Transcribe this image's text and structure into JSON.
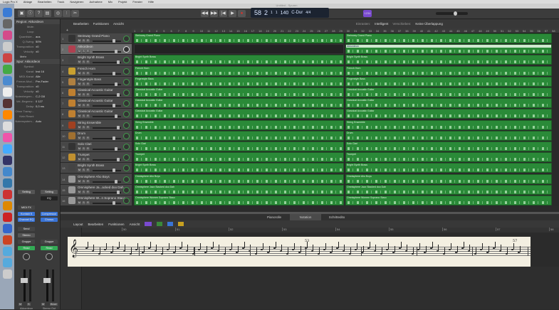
{
  "menubar": {
    "items": [
      "Logic Pro X",
      "Ablage",
      "Bearbeiten",
      "Track",
      "Navigieren",
      "Aufnahme",
      "Mix",
      "Projekt",
      "Fenster",
      "Hilfe"
    ]
  },
  "window": {
    "title": "Untitled - Spuren"
  },
  "lcd": {
    "bar": "58",
    "beat": "2",
    "div": "1",
    "tick": "1",
    "tempo": "140",
    "key": "C-Dur",
    "signature": "4/4"
  },
  "controlbar": {
    "mode_badge": "1234"
  },
  "inspector": {
    "region_header": "Region: Akkordeon",
    "region_rows": [
      {
        "label": "Mute:",
        "value": ""
      },
      {
        "label": "Loop:",
        "value": ""
      },
      {
        "label": "Quantisier...",
        "value": "aus"
      },
      {
        "label": "Q-Swing:",
        "value": "50%"
      },
      {
        "label": "Transposition:",
        "value": "±0"
      },
      {
        "label": "Velocity:",
        "value": "±0"
      }
    ],
    "more": "Mehr",
    "track_header": "Spur: Akkordeon",
    "track_rows": [
      {
        "label": "Symbol:",
        "value": ""
      },
      {
        "label": "Kanal:",
        "value": "Inst 16"
      },
      {
        "label": "MIDI-Kanal:",
        "value": "Alle"
      },
      {
        "label": "Freeze-Mod...",
        "value": "Pre-Fader"
      },
      {
        "label": "Transposition:",
        "value": "±0"
      },
      {
        "label": "Velocity:",
        "value": "±0"
      },
      {
        "label": "Notenbegren...",
        "value": "C-2  G8"
      },
      {
        "label": "Vel.-Begrenz.:",
        "value": "0  127"
      },
      {
        "label": "Delay:",
        "value": "0,0 ms"
      },
      {
        "label": "Ohne Transp...",
        "value": ""
      },
      {
        "label": "Kein Reset:",
        "value": ""
      },
      {
        "label": "Notensystem...",
        "value": "Auto"
      }
    ],
    "strips": [
      {
        "setting": "Setting",
        "eq": "",
        "midi_fx": "MIDI FX",
        "plugin1": "Kontakt 5",
        "plugin2": "Channel EQ",
        "send": "Send",
        "output": "Stereo",
        "group": "Gruppe",
        "automation": "Read",
        "name": "Akkordeon",
        "m": "M",
        "s": "S"
      },
      {
        "setting": "Setting",
        "eq": "EQ",
        "midi_fx": "",
        "plugin1": "Compressor",
        "plugin2": "Chorus",
        "send": "",
        "output": "",
        "group": "Gruppe",
        "automation": "Read",
        "name": "Stereo Out",
        "m": "M",
        "s": "Bnce"
      }
    ]
  },
  "toolbar": {
    "items": [
      "Bearbeiten",
      "Funktionen",
      "Ansicht"
    ],
    "snap_label": "Einrasten:",
    "snap_value": "Intelligent",
    "drag_label": "Verschieben:",
    "drag_value": "Keine Überlappung"
  },
  "ruler": {
    "bars": [
      "1",
      "2",
      "3",
      "4",
      "5",
      "6",
      "7",
      "8",
      "9",
      "10",
      "11",
      "12",
      "13",
      "14",
      "15",
      "16",
      "17",
      "18",
      "19",
      "20",
      "21",
      "22",
      "23",
      "24",
      "25",
      "26",
      "27",
      "28",
      "29",
      "30",
      "31",
      "32",
      "33",
      "34",
      "35",
      "36",
      "37",
      "38",
      "39",
      "40",
      "41",
      "42",
      "43",
      "44",
      "45",
      "46",
      "47",
      "48",
      "49",
      "50",
      "51",
      "52",
      "53",
      "54",
      "55",
      "56",
      "57",
      "58"
    ]
  },
  "tracks": [
    {
      "num": "1",
      "name": "Steinway Grand Piano",
      "r1": "Steinway Grand Piano",
      "r2": "Steinway Grand Piano"
    },
    {
      "num": "2",
      "name": "Akkordeon",
      "r1": "",
      "r2": "Akkordeon"
    },
    {
      "num": "3",
      "name": "Bright Synth Brass",
      "r1": "Bright Synth Brass",
      "r2": "Bright Synth Brass"
    },
    {
      "num": "4",
      "name": "French Horn",
      "r1": "French Horn",
      "r2": "French Horn"
    },
    {
      "num": "5",
      "name": "Fingerstyle Bass",
      "r1": "Fingerstyle Bass",
      "r2": "Fingerstyle Bass"
    },
    {
      "num": "6",
      "name": "Classical Acoustic Guitar",
      "r1": "Classical Acoustic Guitar",
      "r2": "Classical Acoustic Guitar"
    },
    {
      "num": "7",
      "name": "Classical Acoustic Guitar",
      "r1": "Classical Acoustic Guitar",
      "r2": "Classical Acoustic Guitar"
    },
    {
      "num": "8",
      "name": "Classical Acoustic Guitar",
      "r1": "Classical Acoustic Guitar",
      "r2": "Classical Acoustic Guitar"
    },
    {
      "num": "9",
      "name": "String Ensemble",
      "r1": "String Ensemble",
      "r2": "String Ensemble"
    },
    {
      "num": "10",
      "name": "Drum",
      "r1": "Drum",
      "r2": "Drum"
    },
    {
      "num": "11",
      "name": "Solo Clari",
      "r1": "Solo Clari",
      "r2": "Solo Clari"
    },
    {
      "num": "12",
      "name": "Trumpet",
      "r1": "Trumpet",
      "r2": "Trumpet"
    },
    {
      "num": "13",
      "name": "Bright Synth Brass",
      "r1": "Bright Synth Brass",
      "r2": "Bright Synth Brass"
    },
    {
      "num": "14",
      "name": "Omnisphere Aho Boys",
      "r1": "Omnisphere Aho Boys",
      "r2": "Omnisphere Aho Boys"
    },
    {
      "num": "15",
      "name": "Omnisphere Ja...acked doo Dah",
      "r1": "Omnisphere Jazz Stacked doo Dah",
      "r2": "Omnisphere Jazz Stacked doo Dah"
    },
    {
      "num": "16",
      "name": "Omnisphere W...n Soprano Stacc",
      "r1": "Omnisphere Women Soprano Stacc",
      "r2": "Omnisphere Women Soprano Stacc"
    }
  ],
  "track_buttons": {
    "m": "M",
    "s": "S",
    "r": "R"
  },
  "editor": {
    "tabs": [
      "Pianorolle",
      "Notation",
      "Schrittedito"
    ],
    "active_tab": "Notation",
    "toolbar": [
      "Layout",
      "Bearbeiten",
      "Funktionen",
      "Ansicht"
    ],
    "ruler": [
      "50",
      "51",
      "52",
      "53",
      "54",
      "55",
      "56",
      "57",
      "58"
    ],
    "score_measures": [
      "53",
      "57"
    ]
  },
  "colors": {
    "region": "#2a8a38",
    "accent": "#3a74d6",
    "record": "#e0302a"
  }
}
